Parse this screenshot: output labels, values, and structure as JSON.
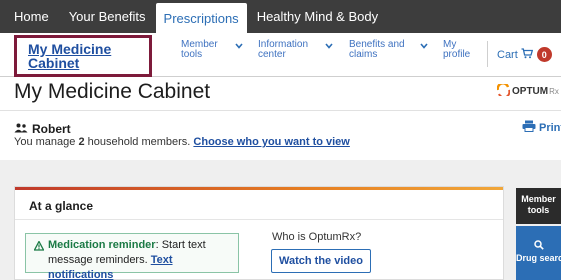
{
  "topnav": {
    "tabs": [
      {
        "label": "Home",
        "active": false
      },
      {
        "label": "Your Benefits",
        "active": false
      },
      {
        "label": "Prescriptions",
        "active": true
      },
      {
        "label": "Healthy Mind & Body",
        "active": false
      }
    ]
  },
  "subnav": {
    "cabinet_link": "My Medicine Cabinet",
    "items": [
      {
        "label": "Member tools"
      },
      {
        "label": "Information center"
      },
      {
        "label": "Benefits and claims"
      },
      {
        "label": "My profile"
      }
    ],
    "cart_label": "Cart",
    "cart_count": "0"
  },
  "page": {
    "title": "My Medicine Cabinet",
    "logo_text": "OPTUM",
    "logo_suffix": "Rx"
  },
  "household": {
    "user_name": "Robert",
    "text_prefix": "You manage ",
    "member_count": "2",
    "text_suffix": " household members. ",
    "choose_link": "Choose who you want to view",
    "print_label": "Print"
  },
  "glance": {
    "title": "At a glance",
    "reminder_lead": "Medication reminder",
    "reminder_text": ": Start text message reminders. ",
    "reminder_link": "Text notifications",
    "who_text": "Who is OptumRx?",
    "watch_button": "Watch the video"
  },
  "side_tools": {
    "member_tools": "Member tools",
    "drug_search": "Drug search"
  },
  "colors": {
    "topnav_bg": "#3d3d3d",
    "link_blue": "#1f4fa0",
    "highlight_box": "#7d1a3a",
    "cart_badge": "#c0392b",
    "reminder_green": "#1b7a45",
    "drug_search_bg": "#2c6eb5"
  }
}
